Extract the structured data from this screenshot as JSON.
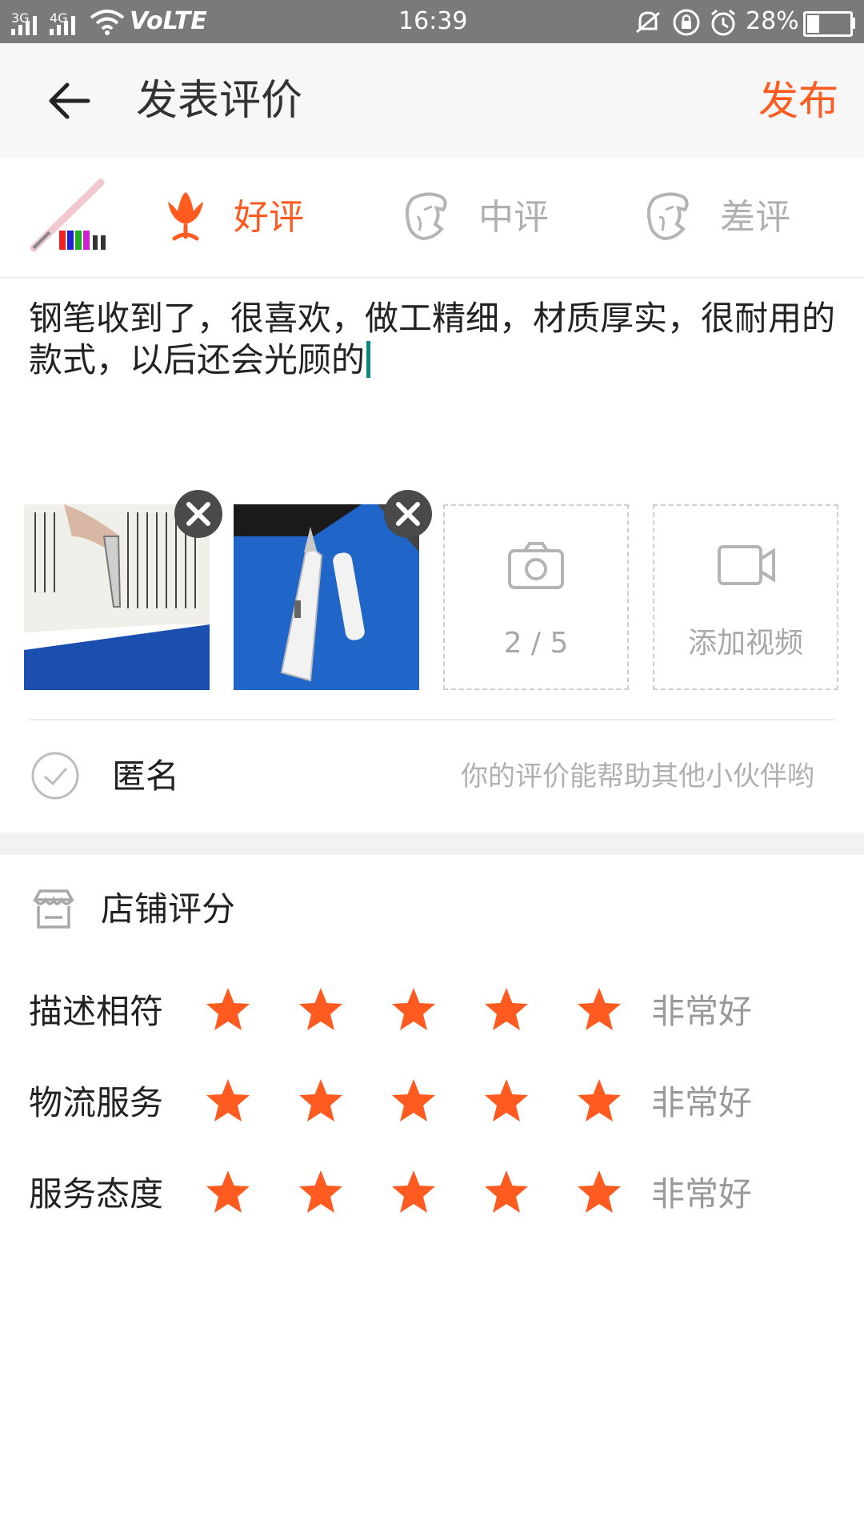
{
  "status": {
    "network1": "3G",
    "network2": "4G",
    "volte": "VoLTE",
    "time": "16:39",
    "battery": "28%",
    "battery_level": 0.28
  },
  "header": {
    "title": "发表评价",
    "publish": "发布"
  },
  "rating_options": [
    {
      "label": "好评",
      "selected": true
    },
    {
      "label": "中评",
      "selected": false
    },
    {
      "label": "差评",
      "selected": false
    }
  ],
  "review_text": "钢笔收到了，很喜欢，做工精细，材质厚实，很耐用的款式，以后还会光顾的",
  "photos": {
    "count_label": "2 / 5",
    "add_video": "添加视频"
  },
  "anonymous": {
    "label": "匿名",
    "hint": "你的评价能帮助其他小伙伴哟"
  },
  "store_rating": {
    "title": "店铺评分",
    "items": [
      {
        "label": "描述相符",
        "stars": 5,
        "quality": "非常好"
      },
      {
        "label": "物流服务",
        "stars": 5,
        "quality": "非常好"
      },
      {
        "label": "服务态度",
        "stars": 5,
        "quality": "非常好"
      }
    ]
  },
  "colors": {
    "accent": "#ff5a1f",
    "muted": "#b4b4b4",
    "statusbar": "#7a7a7a"
  }
}
